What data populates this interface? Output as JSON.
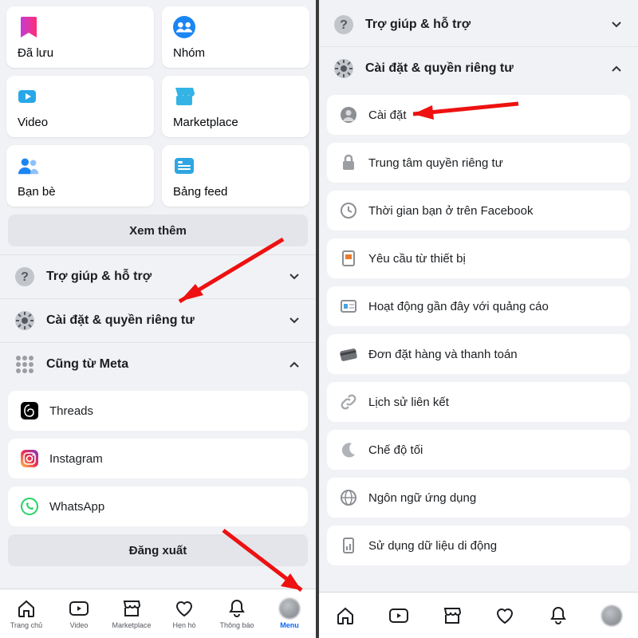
{
  "left": {
    "tiles": [
      {
        "label": "Đã lưu",
        "icon": "saved-icon"
      },
      {
        "label": "Nhóm",
        "icon": "groups-icon"
      },
      {
        "label": "Video",
        "icon": "video-icon"
      },
      {
        "label": "Marketplace",
        "icon": "marketplace-icon"
      },
      {
        "label": "Bạn bè",
        "icon": "friends-icon"
      },
      {
        "label": "Bảng feed",
        "icon": "feeds-icon"
      }
    ],
    "see_more": "Xem thêm",
    "rows": [
      {
        "label": "Trợ giúp & hỗ trợ",
        "icon": "help-icon",
        "open": false
      },
      {
        "label": "Cài đặt & quyền riêng tư",
        "icon": "gear-icon",
        "open": false
      },
      {
        "label": "Cũng từ Meta",
        "icon": "meta-grid-icon",
        "open": true
      }
    ],
    "meta_apps": [
      {
        "label": "Threads",
        "icon": "threads-icon"
      },
      {
        "label": "Instagram",
        "icon": "instagram-icon"
      },
      {
        "label": "WhatsApp",
        "icon": "whatsapp-icon"
      }
    ],
    "logout": "Đăng xuất",
    "tabs": [
      {
        "label": "Trang chủ",
        "icon": "home-icon"
      },
      {
        "label": "Video",
        "icon": "video-tab-icon"
      },
      {
        "label": "Marketplace",
        "icon": "marketplace-tab-icon"
      },
      {
        "label": "Hẹn hò",
        "icon": "dating-icon"
      },
      {
        "label": "Thông báo",
        "icon": "bell-icon"
      },
      {
        "label": "Menu",
        "icon": "avatar",
        "active": true
      }
    ]
  },
  "right": {
    "rows": [
      {
        "label": "Trợ giúp & hỗ trợ",
        "icon": "help-icon",
        "open": false
      },
      {
        "label": "Cài đặt & quyền riêng tư",
        "icon": "gear-icon",
        "open": true
      }
    ],
    "settings": [
      {
        "label": "Cài đặt",
        "icon": "profile-circle-icon"
      },
      {
        "label": "Trung tâm quyền riêng tư",
        "icon": "lock-icon"
      },
      {
        "label": "Thời gian bạn ở trên Facebook",
        "icon": "clock-icon"
      },
      {
        "label": "Yêu cầu từ thiết bị",
        "icon": "device-request-icon"
      },
      {
        "label": "Hoạt động gần đây với quảng cáo",
        "icon": "ad-activity-icon"
      },
      {
        "label": "Đơn đặt hàng và thanh toán",
        "icon": "card-icon"
      },
      {
        "label": "Lịch sử liên kết",
        "icon": "link-icon"
      },
      {
        "label": "Chế độ tối",
        "icon": "moon-icon"
      },
      {
        "label": "Ngôn ngữ ứng dụng",
        "icon": "globe-icon"
      },
      {
        "label": "Sử dụng dữ liệu di động",
        "icon": "data-icon"
      }
    ]
  }
}
